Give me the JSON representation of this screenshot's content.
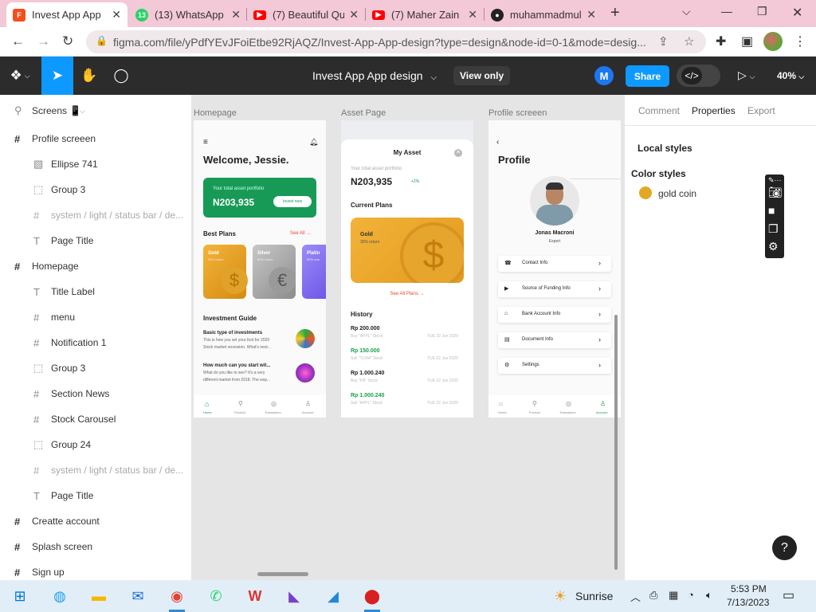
{
  "browser": {
    "tabs": [
      {
        "title": "Invest App App",
        "active": true,
        "color": "#f24e1e"
      },
      {
        "title": "(13) WhatsApp",
        "active": false,
        "color": "#25d366",
        "badge": "13"
      },
      {
        "title": "(7) Beautiful Qu",
        "active": false,
        "color": "#ff0000"
      },
      {
        "title": "(7) Maher Zain",
        "active": false,
        "color": "#ff0000"
      },
      {
        "title": "muhammadmul",
        "active": false,
        "color": "#222222"
      }
    ],
    "url": "figma.com/file/yPdfYEvJFoiEtbe92RjAQZ/Invest-App-App-design?type=design&node-id=0-1&mode=desig..."
  },
  "figma": {
    "file_title": "Invest App App design",
    "view_only": "View only",
    "avatar_letter": "M",
    "share": "Share",
    "zoom": "40%"
  },
  "layers": {
    "header": "Screens 📱",
    "items": [
      {
        "label": "Profile screeen",
        "icon": "#",
        "level": 0
      },
      {
        "label": "Ellipse 741",
        "icon": "img",
        "level": 1
      },
      {
        "label": "Group 3",
        "icon": "grp",
        "level": 1
      },
      {
        "label": "system / light / status bar / de...",
        "icon": "#",
        "level": 1,
        "dim": true
      },
      {
        "label": "Page Title",
        "icon": "T",
        "level": 1
      },
      {
        "label": "Homepage",
        "icon": "#",
        "level": 0
      },
      {
        "label": "Title Label",
        "icon": "T",
        "level": 1
      },
      {
        "label": "menu",
        "icon": "#",
        "level": 1
      },
      {
        "label": "Notification 1",
        "icon": "#",
        "level": 1
      },
      {
        "label": "Group 3",
        "icon": "grp",
        "level": 1
      },
      {
        "label": "Section News",
        "icon": "#",
        "level": 1
      },
      {
        "label": "Stock Carousel",
        "icon": "#",
        "level": 1
      },
      {
        "label": "Group 24",
        "icon": "grp",
        "level": 1
      },
      {
        "label": "system / light / status bar / de...",
        "icon": "#",
        "level": 1,
        "dim": true
      },
      {
        "label": "Page Title",
        "icon": "T",
        "level": 1
      },
      {
        "label": "Creatte account",
        "icon": "#",
        "level": 0
      },
      {
        "label": "Splash screen",
        "icon": "#",
        "level": 0
      },
      {
        "label": "Sign up",
        "icon": "#",
        "level": 0
      }
    ]
  },
  "canvas": {
    "frames": [
      "Homepage",
      "Asset Page",
      "Profile screeen"
    ],
    "home": {
      "welcome": "Welcome, Jessie.",
      "portfolio_label": "Your total asset portfolio",
      "portfolio_value": "N203,935",
      "invest_now": "Invest now",
      "best_plans": "Best Plans",
      "see_all": "See All →",
      "plans": [
        {
          "name": "Gold",
          "sub": "30% return"
        },
        {
          "name": "Silver",
          "sub": "60% return"
        },
        {
          "name": "Platin",
          "sub": "90% retu"
        }
      ],
      "guide": "Investment Guide",
      "guide_items": [
        {
          "title": "Basic type of investments",
          "body1": "This is how you set your foot for 2020",
          "body2": "Stock market recession. What's next..."
        },
        {
          "title": "How much can you start wit...",
          "body1": "What do you like to see? It's a very",
          "body2": "different market from 2018. The way..."
        }
      ],
      "nav": [
        "Home",
        "Product",
        "Transaction",
        "Account"
      ]
    },
    "asset": {
      "title": "My Asset",
      "portfolio_label": "Your total asset portfolio",
      "portfolio_value": "N203,935",
      "change": "+2%",
      "current_plans": "Current Plans",
      "plan_name": "Gold",
      "plan_sub": "30% return",
      "see_all": "See All Plans →",
      "history": "History",
      "history_items": [
        {
          "amount": "Rp 200.000",
          "desc": "Buy \"APPL\" Stock",
          "date": "TUE 22 Jun 2020",
          "color": "#222222"
        },
        {
          "amount": "Rp 150.000",
          "desc": "Sell \"TLKM\" Stock",
          "date": "TUE 22 Jun 2020",
          "color": "#18a34a"
        },
        {
          "amount": "Rp 1.000.240",
          "desc": "Buy \"FB\" Stock",
          "date": "TUE 22 Jun 2020",
          "color": "#222222"
        },
        {
          "amount": "Rp 1.000.240",
          "desc": "Sell \"APPL\" Stock",
          "date": "TUE 22 Jun 2020",
          "color": "#18a34a"
        }
      ]
    },
    "profile": {
      "title": "Profile",
      "name": "Jonas Macroni",
      "role": "Expert",
      "rows": [
        "Contact Info",
        "Source of Funding Info",
        "Bank Account Info",
        "Document Info",
        "Settings"
      ],
      "nav": [
        "Home",
        "Product",
        "Transaction",
        "Account"
      ]
    }
  },
  "right_panel": {
    "tabs": [
      "Comment",
      "Properties",
      "Export"
    ],
    "local_styles": "Local styles",
    "color_styles": "Color styles",
    "style_name": "gold coin",
    "style_color": "#e2a824",
    "help": "?"
  },
  "taskbar": {
    "weather": "Sunrise",
    "time": "5:53 PM",
    "date": "7/13/2023"
  }
}
